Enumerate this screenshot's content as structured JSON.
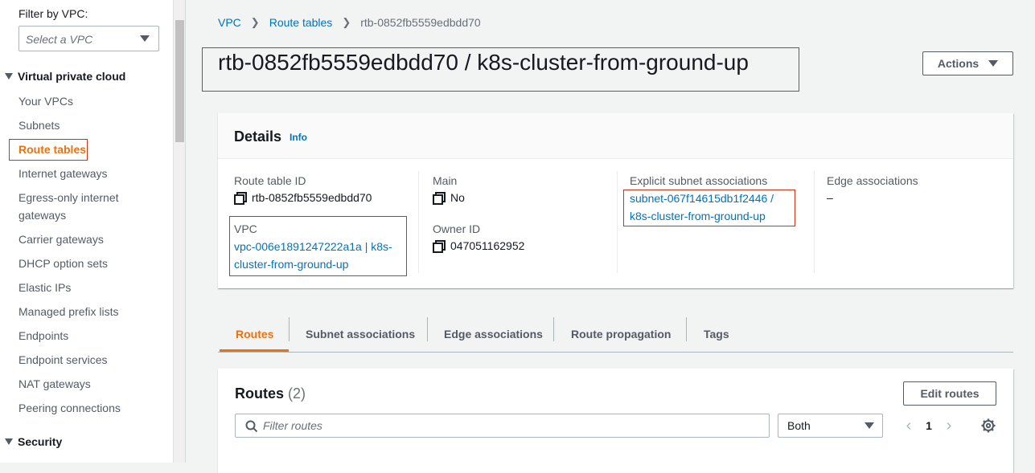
{
  "sidebar": {
    "filter_label": "Filter by VPC:",
    "vpc_select_placeholder": "Select a VPC",
    "section_vpc": "Virtual private cloud",
    "items": [
      {
        "label": "Your VPCs"
      },
      {
        "label": "Subnets"
      },
      {
        "label": "Route tables",
        "active": true
      },
      {
        "label": "Internet gateways"
      },
      {
        "label": "Egress-only internet gateways"
      },
      {
        "label": "Carrier gateways"
      },
      {
        "label": "DHCP option sets"
      },
      {
        "label": "Elastic IPs"
      },
      {
        "label": "Managed prefix lists"
      },
      {
        "label": "Endpoints"
      },
      {
        "label": "Endpoint services"
      },
      {
        "label": "NAT gateways"
      },
      {
        "label": "Peering connections"
      }
    ],
    "section_security": "Security"
  },
  "breadcrumb": {
    "items": [
      "VPC",
      "Route tables",
      "rtb-0852fb5559edbdd70"
    ]
  },
  "page_title": "rtb-0852fb5559edbdd70 / k8s-cluster-from-ground-up",
  "actions_label": "Actions",
  "details": {
    "title": "Details",
    "info": "Info",
    "route_table_id_label": "Route table ID",
    "route_table_id": "rtb-0852fb5559edbdd70",
    "vpc_label": "VPC",
    "vpc_value": "vpc-006e1891247222a1a | k8s-cluster-from-ground-up",
    "vpc_line1": "vpc-006e1891247222a1a | k8s-",
    "vpc_line2": "cluster-from-ground-up",
    "main_label": "Main",
    "main_value": "No",
    "owner_label": "Owner ID",
    "owner_value": "047051162952",
    "explicit_label": "Explicit subnet associations",
    "explicit_line1": "subnet-067f14615db1f2446 /",
    "explicit_line2": "k8s-cluster-from-ground-up",
    "edge_label": "Edge associations",
    "edge_value": "–"
  },
  "tabs": [
    {
      "label": "Routes",
      "active": true
    },
    {
      "label": "Subnet associations"
    },
    {
      "label": "Edge associations"
    },
    {
      "label": "Route propagation"
    },
    {
      "label": "Tags"
    }
  ],
  "routes": {
    "title": "Routes",
    "count": "(2)",
    "edit_label": "Edit routes",
    "filter_placeholder": "Filter routes",
    "select_value": "Both",
    "page": "1"
  },
  "colors": {
    "accent": "#ec7211",
    "link": "#0073bb",
    "highlight_box": "#d13212"
  }
}
